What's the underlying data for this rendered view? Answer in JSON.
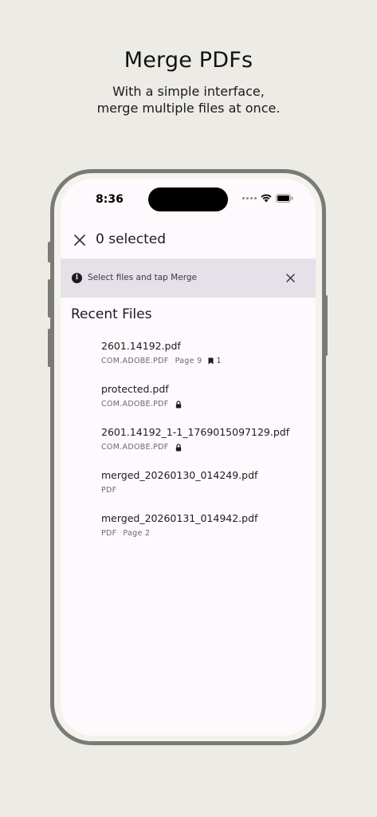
{
  "promo": {
    "title": "Merge PDFs",
    "subtitle_line1": "With a simple interface,",
    "subtitle_line2": "merge multiple files at once."
  },
  "status_bar": {
    "time": "8:36",
    "icons": [
      "cellular-dots-icon",
      "wifi-icon",
      "battery-icon"
    ]
  },
  "top_bar": {
    "selected_text": "0 selected",
    "close_icon": "close-icon"
  },
  "banner": {
    "text": "Select files and tap Merge",
    "icon": "info-icon",
    "close_icon": "close-icon"
  },
  "recent": {
    "title": "Recent Files",
    "files": [
      {
        "name": "2601.14192.pdf",
        "source": "COM.ADOBE.PDF",
        "page": "Page 9",
        "bookmarks": "1"
      },
      {
        "name": "protected.pdf",
        "source": "COM.ADOBE.PDF",
        "locked": true
      },
      {
        "name": "2601.14192_1-1_1769015097129.pdf",
        "source": "COM.ADOBE.PDF",
        "locked": true
      },
      {
        "name": "merged_20260130_014249.pdf",
        "source": "PDF"
      },
      {
        "name": "merged_20260131_014942.pdf",
        "source": "PDF",
        "page": "Page 2"
      }
    ]
  },
  "colors": {
    "background": "#edebe5",
    "screen": "#fdf9fc",
    "banner": "#e6e0e9",
    "frame": "#7a7a76"
  }
}
